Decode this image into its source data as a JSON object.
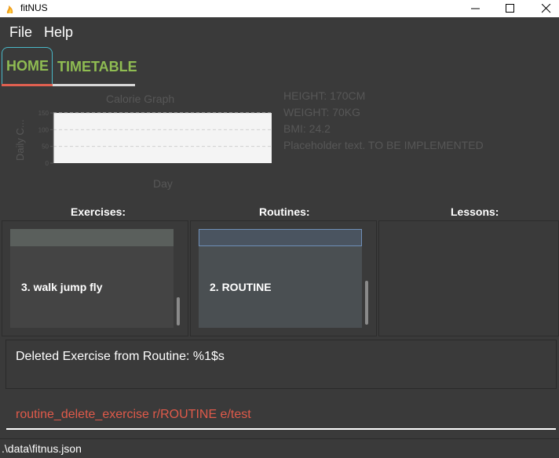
{
  "window": {
    "title": "fitNUS",
    "icon": "app-icon",
    "controls": [
      "minimize-icon",
      "maximize-icon",
      "close-icon"
    ]
  },
  "menu": {
    "file": "File",
    "help": "Help"
  },
  "tabs": {
    "home": "HOME",
    "timetable": "TIMETABLE",
    "active": "home"
  },
  "chart_data": {
    "type": "line",
    "title": "Calorie Graph",
    "xlabel": "Day",
    "ylabel": "Daily C...",
    "ylim": [
      0,
      150
    ],
    "y_ticks": [
      "0",
      "50",
      "100",
      "150"
    ],
    "grid": true,
    "series": []
  },
  "stats": {
    "height": "HEIGHT: 170CM",
    "weight": "WEIGHT: 70KG",
    "bmi": "BMI: 24.2",
    "note": "Placeholder text. TO BE IMPLEMENTED"
  },
  "sections": {
    "exercises": "Exercises:",
    "routines": "Routines:",
    "lessons": "Lessons:"
  },
  "exercises_list": {
    "visible_item": "3.  walk jump fly"
  },
  "routines_list": {
    "visible_item": "2.  ROUTINE"
  },
  "result": {
    "text": "Deleted Exercise from Routine: %1$s"
  },
  "command": {
    "value": "routine_delete_exercise r/ROUTINE e/test"
  },
  "status": {
    "path": ".\\data\\fitnus.json"
  },
  "colors": {
    "background": "#3a3a3a",
    "tab_text": "#8fbc52",
    "tab_active_border": "#4ab8c8",
    "tab_underline": "#e06050",
    "command_text": "#e05a4a"
  }
}
